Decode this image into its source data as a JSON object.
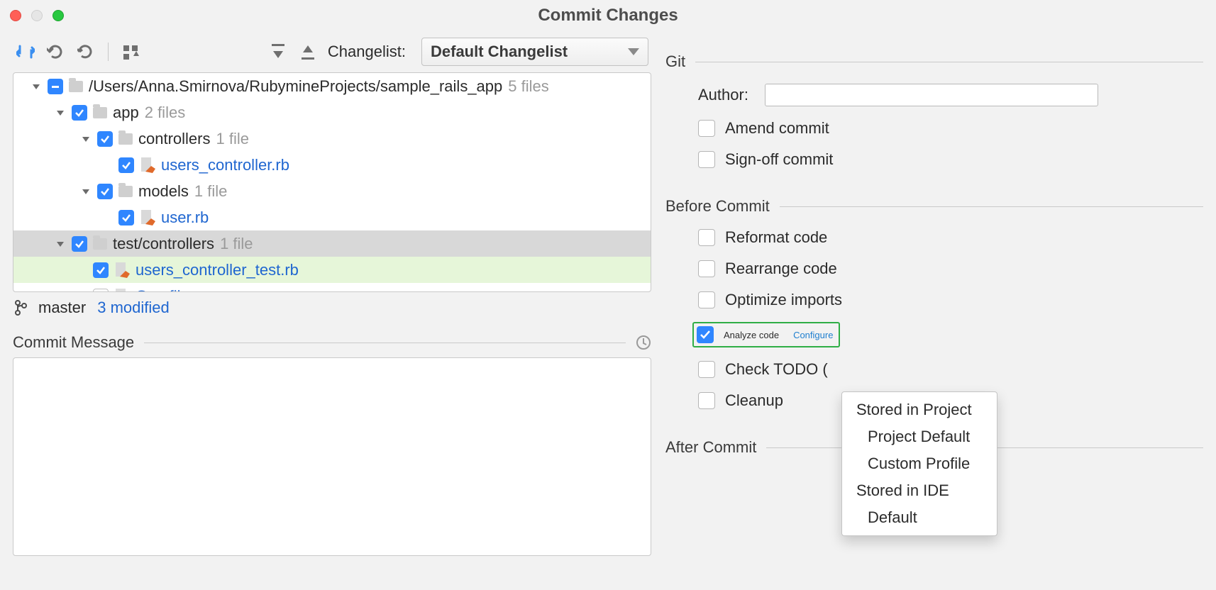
{
  "window": {
    "title": "Commit Changes"
  },
  "toolbar": {
    "changelist_label": "Changelist:",
    "changelist_value": "Default Changelist"
  },
  "tree": {
    "root": {
      "path": "/Users/Anna.Smirnova/RubymineProjects/sample_rails_app",
      "count": "5 files"
    },
    "app": {
      "name": "app",
      "count": "2 files"
    },
    "controllers": {
      "name": "controllers",
      "count": "1 file"
    },
    "users_controller": {
      "name": "users_controller.rb"
    },
    "models": {
      "name": "models",
      "count": "1 file"
    },
    "user_rb": {
      "name": "user.rb"
    },
    "test_controllers": {
      "name": "test/controllers",
      "count": "1 file"
    },
    "users_controller_test": {
      "name": "users_controller_test.rb"
    },
    "gemfile": {
      "name": "Gemfile"
    }
  },
  "branch": {
    "name": "master",
    "status": "3 modified"
  },
  "commit_message": {
    "label": "Commit Message"
  },
  "git_section": {
    "title": "Git",
    "author_label": "Author:",
    "author_value": "",
    "amend": "Amend commit",
    "signoff": "Sign-off commit"
  },
  "before_commit": {
    "title": "Before Commit",
    "reformat": "Reformat code",
    "rearrange": "Rearrange code",
    "optimize": "Optimize imports",
    "analyze": "Analyze code",
    "configure": "Configure",
    "check_todo": "Check TODO (",
    "cleanup": "Cleanup"
  },
  "after_commit": {
    "title": "After Commit"
  },
  "popup": {
    "items": [
      "Stored in Project",
      "Project Default",
      "Custom Profile",
      "Stored in IDE",
      "Default"
    ]
  }
}
